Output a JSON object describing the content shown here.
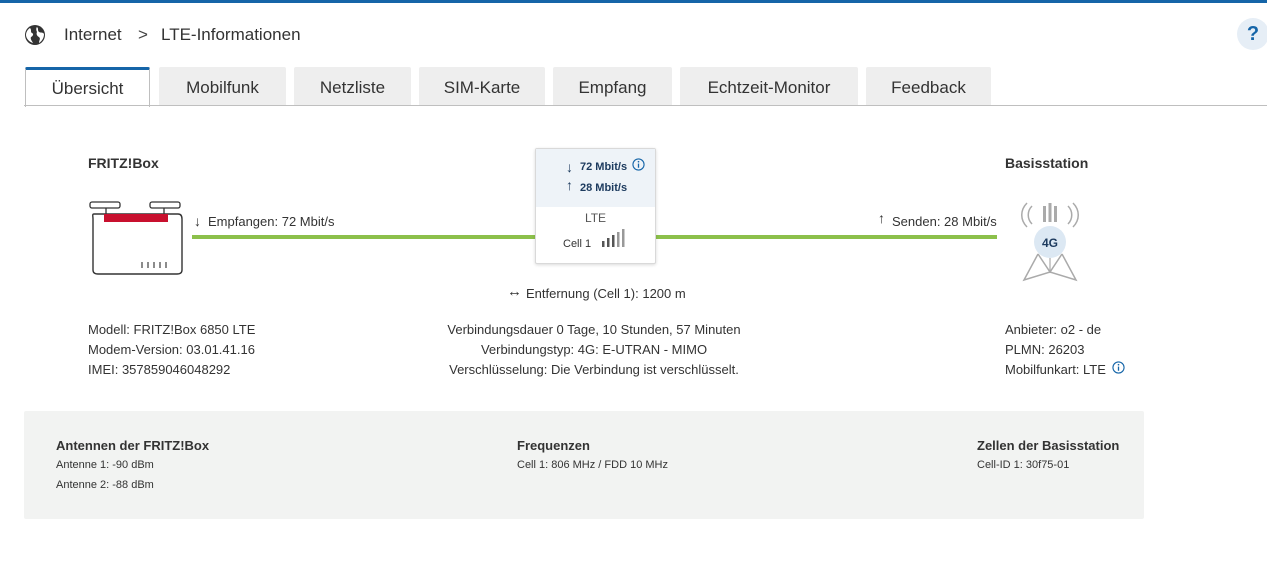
{
  "breadcrumb": {
    "root": "Internet",
    "separator": ">",
    "current": "LTE-Informationen"
  },
  "help": {
    "label": "?"
  },
  "tabs": [
    {
      "label": "Übersicht",
      "active": true
    },
    {
      "label": "Mobilfunk"
    },
    {
      "label": "Netzliste"
    },
    {
      "label": "SIM-Karte"
    },
    {
      "label": "Empfang"
    },
    {
      "label": "Echtzeit-Monitor"
    },
    {
      "label": "Feedback"
    }
  ],
  "device": {
    "title": "FRITZ!Box",
    "receive": "Empfangen: 72 Mbit/s",
    "model": "Modell: FRITZ!Box 6850 LTE",
    "modem_version": "Modem-Version: 03.01.41.16",
    "imei": "IMEI: 357859046048292"
  },
  "link": {
    "down": "72 Mbit/s",
    "up": "28 Mbit/s",
    "tech": "LTE",
    "cell": "Cell 1",
    "signal_bars": 4,
    "distance": "Entfernung (Cell 1): 1200 m",
    "duration": "Verbindungsdauer 0 Tage, 10 Stunden, 57 Minuten",
    "type": "Verbindungstyp: 4G: E-UTRAN - MIMO",
    "encryption": "Verschlüsselung: Die Verbindung ist verschlüsselt."
  },
  "station": {
    "title": "Basisstation",
    "send": "Senden: 28 Mbit/s",
    "badge": "4G",
    "provider": "Anbieter: o2 - de",
    "plmn": "PLMN: 26203",
    "card": "Mobilfunkart: LTE"
  },
  "panel": {
    "antennas": {
      "title": "Antennen der FRITZ!Box",
      "items": [
        "Antenne 1: -90 dBm",
        "Antenne 2: -88 dBm"
      ]
    },
    "frequencies": {
      "title": "Frequenzen",
      "items": [
        "Cell 1: 806 MHz / FDD 10 MHz"
      ]
    },
    "cells": {
      "title": "Zellen der Basisstation",
      "items": [
        "Cell-ID 1: 30f75-01"
      ]
    }
  },
  "colors": {
    "accent": "#1565a8",
    "link_line": "#8cc04b",
    "router_red": "#c8102e"
  },
  "icons": {
    "globe": "globe-icon",
    "router": "router-icon",
    "tower": "cell-tower-icon",
    "info": "info-icon",
    "signal": "signal-bars-icon"
  }
}
